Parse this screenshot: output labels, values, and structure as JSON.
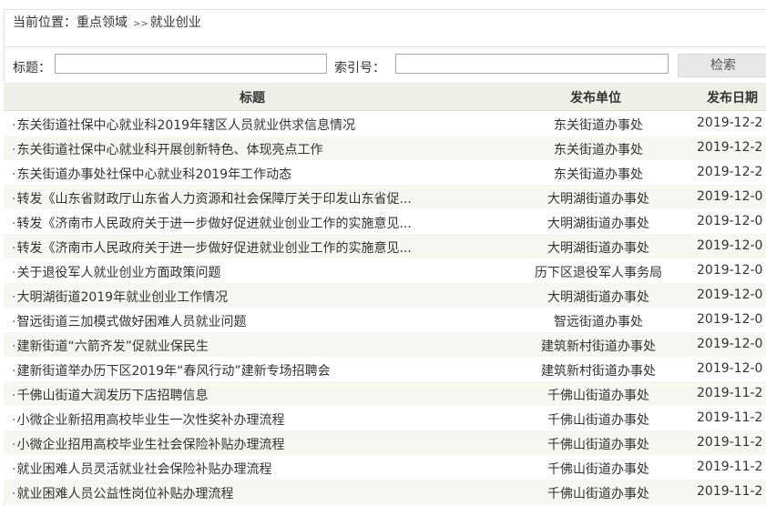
{
  "breadcrumb": {
    "prefix": "当前位置：",
    "section": "重点领域",
    "separator": ">>",
    "current": "就业创业"
  },
  "search": {
    "title_label": "标题：",
    "title_value": "",
    "index_label": "索引号：",
    "index_value": "",
    "button_label": "检索"
  },
  "table": {
    "headers": {
      "title": "标题",
      "unit": "发布单位",
      "date": "发布日期"
    },
    "rows": [
      {
        "bullet": "·",
        "title": "东关街道社保中心就业科2019年辖区人员就业供求信息情况",
        "unit": "东关街道办事处",
        "date": "2019-12-2"
      },
      {
        "bullet": "·",
        "title": "东关街道社保中心就业科开展创新特色、体现亮点工作",
        "unit": "东关街道办事处",
        "date": "2019-12-2"
      },
      {
        "bullet": "·",
        "title": "东关街道办事处社保中心就业科2019年工作动态",
        "unit": "东关街道办事处",
        "date": "2019-12-2"
      },
      {
        "bullet": "·",
        "title": "转发《山东省财政厅山东省人力资源和社会保障厅关于印发山东省促...",
        "unit": "大明湖街道办事处",
        "date": "2019-12-0"
      },
      {
        "bullet": "·",
        "title": "转发《济南市人民政府关于进一步做好促进就业创业工作的实施意见...",
        "unit": "大明湖街道办事处",
        "date": "2019-12-0"
      },
      {
        "bullet": "·",
        "title": "转发《济南市人民政府关于进一步做好促进就业创业工作的实施意见...",
        "unit": "大明湖街道办事处",
        "date": "2019-12-0"
      },
      {
        "bullet": "·",
        "title": "关于退役军人就业创业方面政策问题",
        "unit": "历下区退役军人事务局",
        "date": "2019-12-0"
      },
      {
        "bullet": "·",
        "title": "大明湖街道2019年就业创业工作情况",
        "unit": "大明湖街道办事处",
        "date": "2019-12-0"
      },
      {
        "bullet": "·",
        "title": "智远街道三加模式做好困难人员就业问题",
        "unit": "智远街道办事处",
        "date": "2019-12-0"
      },
      {
        "bullet": "·",
        "title": "建新街道“六箭齐发”促就业保民生",
        "unit": "建筑新村街道办事处",
        "date": "2019-12-0"
      },
      {
        "bullet": "·",
        "title": "建新街道举办历下区2019年“春风行动”建新专场招聘会",
        "unit": "建筑新村街道办事处",
        "date": "2019-12-0"
      },
      {
        "bullet": "·",
        "title": "千佛山街道大润发历下店招聘信息",
        "unit": "千佛山街道办事处",
        "date": "2019-11-2"
      },
      {
        "bullet": "·",
        "title": "小微企业新招用高校毕业生一次性奖补办理流程",
        "unit": "千佛山街道办事处",
        "date": "2019-11-2"
      },
      {
        "bullet": "·",
        "title": "小微企业招用高校毕业生社会保险补贴办理流程",
        "unit": "千佛山街道办事处",
        "date": "2019-11-2"
      },
      {
        "bullet": "·",
        "title": "就业困难人员灵活就业社会保险补贴办理流程",
        "unit": "千佛山街道办事处",
        "date": "2019-11-2"
      },
      {
        "bullet": "·",
        "title": "就业困难人员公益性岗位补贴办理流程",
        "unit": "千佛山街道办事处",
        "date": "2019-11-2"
      }
    ]
  },
  "colors": {
    "header_bg": "#efeee7",
    "alt_row_bg": "#f7f6f0",
    "text": "#333333",
    "button_bg": "#e8e8e8"
  }
}
